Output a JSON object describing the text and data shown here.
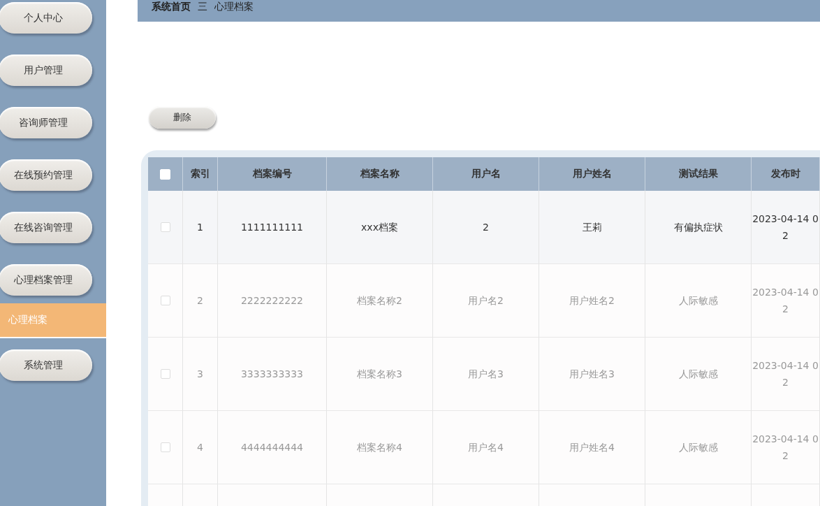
{
  "sidebar": {
    "items": [
      {
        "label": "个人中心",
        "kind": "menu",
        "selected": false
      },
      {
        "label": "用户管理",
        "kind": "menu",
        "selected": false
      },
      {
        "label": "咨询师管理",
        "kind": "menu",
        "selected": false
      },
      {
        "label": "在线预约管理",
        "kind": "menu",
        "selected": false
      },
      {
        "label": "在线咨询管理",
        "kind": "menu",
        "selected": false
      },
      {
        "label": "心理档案管理",
        "kind": "menu",
        "selected": false
      },
      {
        "label": "心理档案",
        "kind": "submenu",
        "selected": true
      },
      {
        "label": "系统管理",
        "kind": "menu",
        "selected": false
      }
    ]
  },
  "breadcrumb": {
    "home": "系统首页",
    "separator": "三",
    "current": "心理档案"
  },
  "toolbar": {
    "delete_button": "删除"
  },
  "table": {
    "select_all_checked": false,
    "columns": [
      "索引",
      "档案编号",
      "档案名称",
      "用户名",
      "用户姓名",
      "测试结果",
      "发布时"
    ],
    "rows": [
      {
        "checked": false,
        "highlighted": true,
        "cells": [
          "1",
          "1111111111",
          "xxx档案",
          "2",
          "王莉",
          "有偏执症状"
        ],
        "time": [
          "2023-04-14 0",
          "2"
        ]
      },
      {
        "checked": false,
        "highlighted": false,
        "cells": [
          "2",
          "2222222222",
          "档案名称2",
          "用户名2",
          "用户姓名2",
          "人际敏感"
        ],
        "time": [
          "2023-04-14 0",
          "2"
        ]
      },
      {
        "checked": false,
        "highlighted": false,
        "cells": [
          "3",
          "3333333333",
          "档案名称3",
          "用户名3",
          "用户姓名3",
          "人际敏感"
        ],
        "time": [
          "2023-04-14 0",
          "2"
        ]
      },
      {
        "checked": false,
        "highlighted": false,
        "cells": [
          "4",
          "4444444444",
          "档案名称4",
          "用户名4",
          "用户姓名4",
          "人际敏感"
        ],
        "time": [
          "2023-04-14 0",
          "2"
        ]
      }
    ]
  }
}
